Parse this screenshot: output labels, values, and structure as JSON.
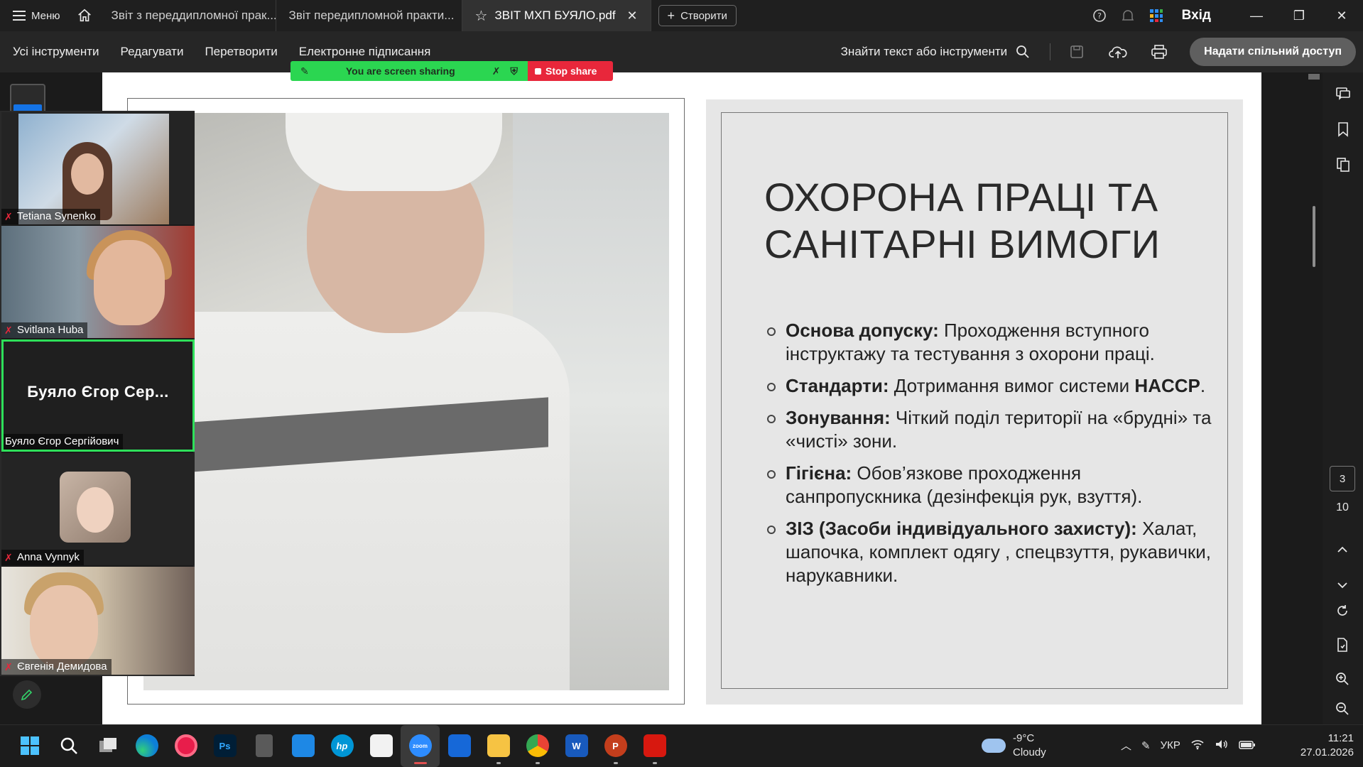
{
  "titlebar": {
    "menu_label": "Меню",
    "tabs": [
      {
        "label": "Звіт з переддипломної прак..."
      },
      {
        "label": "Звіт передипломной практи..."
      },
      {
        "label": "ЗВІТ МХП БУЯЛО.pdf"
      }
    ],
    "create_label": "Створити",
    "signin_label": "Вхід"
  },
  "toolbar": {
    "items": [
      "Усі інструменти",
      "Редагувати",
      "Перетворити",
      "Електронне підписання"
    ],
    "find_label": "Знайти текст або інструменти",
    "share_label": "Надати спільний доступ"
  },
  "screenshare": {
    "status": "You are screen sharing",
    "stop_label": "Stop share",
    "status_color": "#2bd651",
    "stop_color": "#e8273b"
  },
  "slide": {
    "title": "ОХОРОНА ПРАЦІ ТА САНІТАРНІ ВИМОГИ",
    "bullets": [
      {
        "bold": "Основа допуску:",
        "text": " Проходження вступного інструктажу та тестування з охорони праці."
      },
      {
        "bold": "Стандарти:",
        "text": " Дотримання вимог системи ",
        "bold2": "HACCP",
        "tail": "."
      },
      {
        "bold": "Зонування:",
        "text": " Чіткий поділ території на «брудні» та «чисті» зони."
      },
      {
        "bold": "Гігієна:",
        "text": " Обов’язкове проходження санпропускника (дезінфекція рук, взуття)."
      },
      {
        "bold": "ЗІЗ (Засоби індивідуального захисту):",
        "text": " Халат, шапочка, комплект одягу , спецвзуття, рукавички, нарукавники."
      }
    ]
  },
  "pager": {
    "current": "3",
    "total": "10"
  },
  "participants": [
    {
      "name": "Tetiana Synenko",
      "muted": true
    },
    {
      "name": "Svitlana Huba",
      "muted": true
    },
    {
      "name": "Буяло Єгор Сергійович",
      "display": "Буяло Єгор Сер...",
      "muted": false,
      "active": true
    },
    {
      "name": "Anna Vynnyk",
      "muted": true
    },
    {
      "name": "Євгенія Демидова",
      "muted": true
    }
  ],
  "taskbar": {
    "apps": [
      "start-icon",
      "search-icon",
      "task-view-icon",
      "edge-icon",
      "screen-recorder-icon",
      "photoshop-icon",
      "calculator-icon",
      "store-icon",
      "hp-icon",
      "paint-icon",
      "zoom-icon",
      "visio-icon",
      "file-explorer-icon",
      "chrome-icon",
      "word-icon",
      "powerpoint-icon",
      "acrobat-icon"
    ],
    "ps_label": "Ps",
    "hp_label": "hp",
    "zoom_label": "zoom",
    "word_label": "W",
    "ppt_label": "P",
    "weather_temp": "-9°C",
    "weather_text": "Cloudy",
    "lang": "УКР",
    "time": "11:21",
    "date": "27.01.2026"
  },
  "colors": {
    "accent": "#1473e6",
    "active_tile": "#2ee05a",
    "muted_mic": "#e8273b"
  }
}
